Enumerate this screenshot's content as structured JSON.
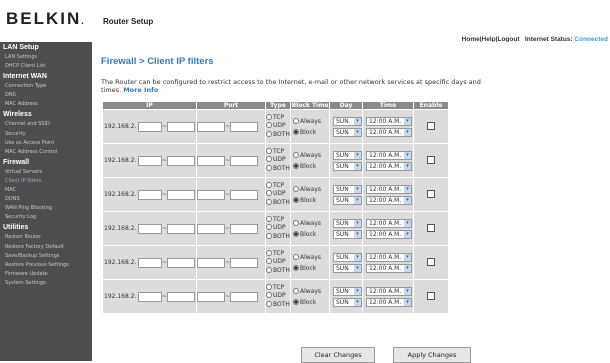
{
  "header": {
    "logo": "BELKIN",
    "logo_dot": ".",
    "router_setup": "Router Setup",
    "home": "Home",
    "help": "Help",
    "logout": "Logout",
    "sep": "|",
    "internet_status_label": "Internet Status:",
    "internet_status_value": "Connected"
  },
  "sidebar": {
    "sections": [
      {
        "heading": "LAN Setup",
        "items": [
          "LAN Settings",
          "DHCP Client List"
        ]
      },
      {
        "heading": "Internet WAN",
        "items": [
          "Connection Type",
          "DNS",
          "MAC Address"
        ]
      },
      {
        "heading": "Wireless",
        "items": [
          "Channel and SSID",
          "Security",
          "Use as Access Point",
          "MAC Address Control"
        ]
      },
      {
        "heading": "Firewall",
        "items": [
          "Virtual Servers",
          "Client IP filters",
          "MAC",
          "DDNS",
          "WAN Ping Blocking",
          "Security Log"
        ]
      },
      {
        "heading": "Utilities",
        "items": [
          "Restart Router",
          "Restore Factory Default",
          "Save/Backup Settings",
          "Restore Previous Settings",
          "Firmware Update",
          "System Settings"
        ]
      }
    ],
    "active_item": "Client IP filters"
  },
  "main": {
    "title": "Firewall > Client IP filters",
    "description": "The Router can be configured to restrict access to the Internet, e-mail or other network services at specific days and times.",
    "more_info": "More Info"
  },
  "table": {
    "headers": [
      "IP",
      "Port",
      "Type",
      "Block Time",
      "Day",
      "Time",
      "Enable"
    ],
    "type_options": [
      "TCP",
      "UDP",
      "BOTH"
    ],
    "block_options": [
      "Always",
      "Block"
    ],
    "ip_sep": "~",
    "port_sep": "~",
    "rows": [
      {
        "ip_prefix": "192.168.2.",
        "day_from": "SUN",
        "day_to": "SUN",
        "time_from": "12:00 A.M.",
        "time_to": "12:00 A.M."
      },
      {
        "ip_prefix": "192.168.2.",
        "day_from": "SUN",
        "day_to": "SUN",
        "time_from": "12:00 A.M.",
        "time_to": "12:00 A.M."
      },
      {
        "ip_prefix": "192.168.2.",
        "day_from": "SUN",
        "day_to": "SUN",
        "time_from": "12:00 A.M.",
        "time_to": "12:00 A.M."
      },
      {
        "ip_prefix": "192.168.2.",
        "day_from": "SUN",
        "day_to": "SUN",
        "time_from": "12:00 A.M.",
        "time_to": "12:00 A.M."
      },
      {
        "ip_prefix": "192.168.2.",
        "day_from": "SUN",
        "day_to": "SUN",
        "time_from": "12:00 A.M.",
        "time_to": "12:00 A.M."
      },
      {
        "ip_prefix": "192.168.2.",
        "day_from": "SUN",
        "day_to": "SUN",
        "time_from": "12:00 A.M.",
        "time_to": "12:00 A.M."
      }
    ]
  },
  "buttons": {
    "clear": "Clear Changes",
    "apply": "Apply Changes"
  },
  "icons": {
    "dropdown": "chevron-down-icon"
  },
  "colors": {
    "accent": "#3a78b8",
    "connected": "#3aa0d8",
    "sidebar_bg": "#4e4e4e",
    "header_bg": "#8a8a8a"
  }
}
